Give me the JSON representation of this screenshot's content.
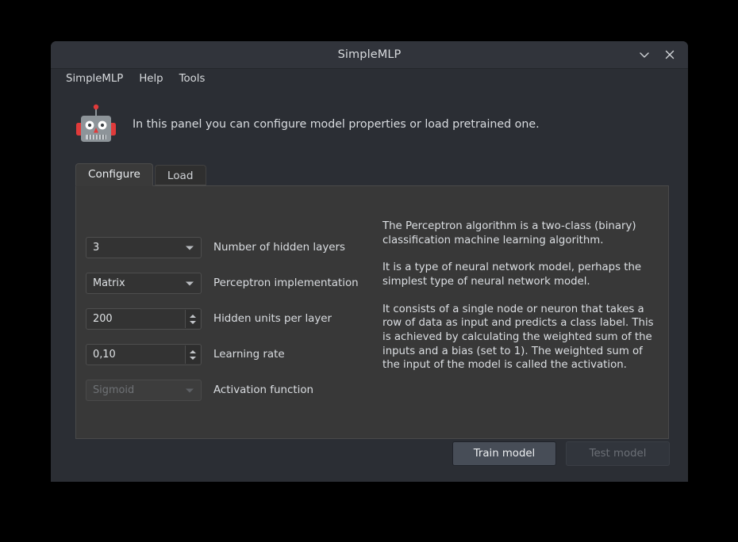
{
  "window": {
    "title": "SimpleMLP",
    "controls": [
      {
        "name": "minimize-button",
        "glyph": "chevron-down-icon"
      },
      {
        "name": "close-button",
        "glyph": "close-icon"
      }
    ]
  },
  "menubar": {
    "items": [
      {
        "label": "SimpleMLP"
      },
      {
        "label": "Help"
      },
      {
        "label": "Tools"
      }
    ]
  },
  "header": {
    "icon": "robot-icon",
    "text": "In this panel you can configure model properties or load pretrained one."
  },
  "tabs": [
    {
      "label": "Configure",
      "active": true
    },
    {
      "label": "Load",
      "active": false
    }
  ],
  "form": {
    "fields": [
      {
        "kind": "combobox",
        "value": "3",
        "label": "Number of hidden layers",
        "disabled": false
      },
      {
        "kind": "combobox",
        "value": "Matrix",
        "label": "Perceptron implementation",
        "disabled": false
      },
      {
        "kind": "spinbox",
        "value": "200",
        "label": "Hidden units per layer",
        "disabled": false
      },
      {
        "kind": "spinbox",
        "value": "0,10",
        "label": "Learning rate",
        "disabled": false
      },
      {
        "kind": "combobox",
        "value": "Sigmoid",
        "label": "Activation function",
        "disabled": true
      }
    ]
  },
  "description": {
    "paragraphs": [
      "The Perceptron algorithm is a two-class (binary) classification machine learning algorithm.",
      "It is a type of neural network model, perhaps the simplest type of neural network model.",
      "It consists of a single node or neuron that takes a row of data as input and predicts a class label. This is achieved by calculating the weighted sum of the inputs and a bias (set to 1). The weighted sum of the input of the model is called the activation."
    ]
  },
  "footer": {
    "train_label": "Train model",
    "test_label": "Test model",
    "test_disabled": true
  },
  "colors": {
    "desktop": "#000000",
    "window_body": "#2b2e34",
    "titlebar": "#31343b",
    "panel": "#383838",
    "field": "#333333",
    "primary_button": "#474d57",
    "robot_accent": "#e03a3a",
    "robot_body": "#8d9499",
    "text": "#dcdfe3"
  }
}
